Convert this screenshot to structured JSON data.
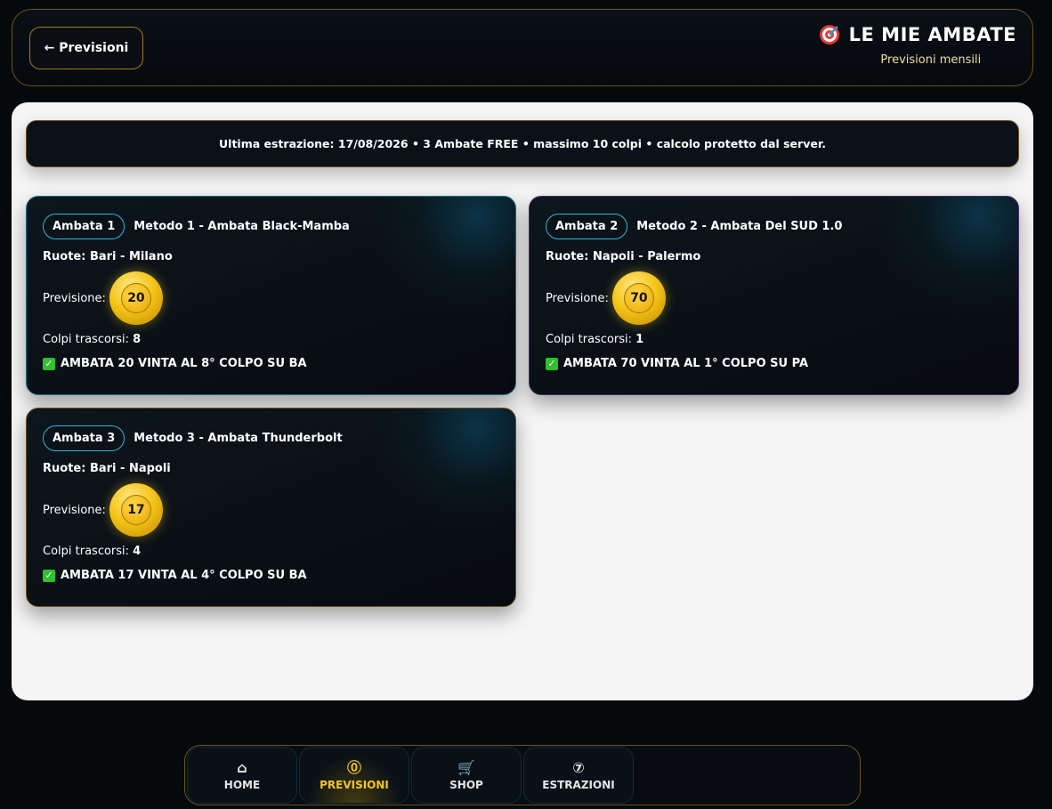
{
  "header": {
    "back_label": "← Previsioni",
    "title": "LE MIE AMBATE",
    "subtitle": "Previsioni mensili"
  },
  "info_bar": "Ultima estrazione: 17/08/2026 • 3 Ambate FREE • massimo 10 colpi • calcolo protetto dal server.",
  "cards": [
    {
      "badge": "Ambata 1",
      "method": "Metodo 1 - Ambata Black-Mamba",
      "wheels": "Ruote: Bari - Milano",
      "prediction_label": "Previsione:",
      "number": "20",
      "colpi_label": "Colpi trascorsi:",
      "colpi_value": "8",
      "result": "AMBATA 20 VINTA AL 8° COLPO SU BA"
    },
    {
      "badge": "Ambata 2",
      "method": "Metodo 2 - Ambata Del SUD 1.0",
      "wheels": "Ruote: Napoli - Palermo",
      "prediction_label": "Previsione:",
      "number": "70",
      "colpi_label": "Colpi trascorsi:",
      "colpi_value": "1",
      "result": "AMBATA 70 VINTA AL 1° COLPO SU PA"
    },
    {
      "badge": "Ambata 3",
      "method": "Metodo 3 - Ambata Thunderbolt",
      "wheels": "Ruote: Bari - Napoli",
      "prediction_label": "Previsione:",
      "number": "17",
      "colpi_label": "Colpi trascorsi:",
      "colpi_value": "4",
      "result": "AMBATA 17 VINTA AL 4° COLPO SU BA"
    }
  ],
  "nav": [
    {
      "label": "HOME",
      "icon": "home-icon",
      "glyph": "⌂"
    },
    {
      "label": "PREVISIONI",
      "icon": "coin-icon",
      "glyph": "⓪"
    },
    {
      "label": "SHOP",
      "icon": "cart-icon",
      "glyph": "🛒"
    },
    {
      "label": "ESTRAZIONI",
      "icon": "ball-number-icon",
      "glyph": "⑦"
    }
  ],
  "colors": {
    "accent_gold": "#f5c518",
    "border_gold": "#6b5416",
    "badge_cyan": "#2bb6d6",
    "success_green": "#2fbf2f"
  }
}
